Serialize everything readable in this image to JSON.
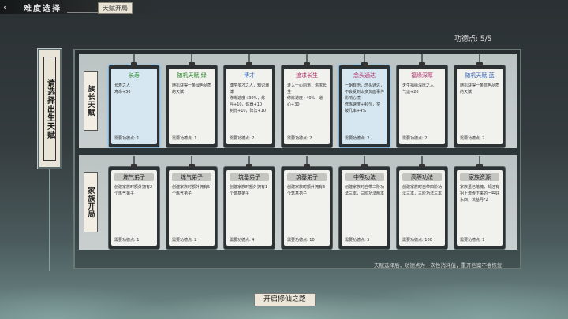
{
  "header": {
    "back_icon": "back-arrow-icon",
    "title": "难度选择",
    "tab_label": "天赋开局"
  },
  "points": {
    "label": "功德点: 5/5"
  },
  "side_label": "请选择出生天赋",
  "rows": [
    {
      "label": "族长天赋",
      "cards": [
        {
          "name": "长寿",
          "name_color": "#2a8a2a",
          "selected": true,
          "desc": "长寿之人",
          "effects": "寿命+50",
          "cost": "需要功德点: 1"
        },
        {
          "name": "随机天赋·绿",
          "name_color": "#2a8a2a",
          "selected": false,
          "desc": "随机获得一条绿色品质的天赋",
          "effects": "",
          "cost": "需要功德点: 1"
        },
        {
          "name": "博才",
          "name_color": "#3a6ab8",
          "selected": false,
          "desc": "博学多才之人，知识渊博",
          "effects": "修炼速度+30%，炼丹+10，炼器+10，制符+10，阵法+10",
          "cost": "需要功德点: 2"
        },
        {
          "name": "追求长生",
          "name_color": "#b0306a",
          "selected": false,
          "desc": "走入一心向道，追求长生",
          "effects": "修炼速度+40%，道心+30",
          "cost": "需要功德点: 2"
        },
        {
          "name": "念头通达",
          "name_color": "#b0306a",
          "selected": true,
          "desc": "一朝有悟，念头通达，不会受到太多负面事件影响心境",
          "effects": "修炼速度+40%，突破几率+4%",
          "cost": "需要功德点: 2"
        },
        {
          "name": "福缘深厚",
          "name_color": "#b0306a",
          "selected": false,
          "desc": "天生福缘深厚之人",
          "effects": "气运+20",
          "cost": "需要功德点: 2"
        },
        {
          "name": "随机天赋·蓝",
          "name_color": "#3a6ab8",
          "selected": false,
          "desc": "随机获得一条蓝色品质的天赋",
          "effects": "",
          "cost": "需要功德点: 2"
        }
      ]
    },
    {
      "label": "家族开局",
      "cards": [
        {
          "name": "炼气弟子",
          "selected": false,
          "desc": "创建家族时额外拥有2个炼气弟子",
          "cost": "需要功德点: 1"
        },
        {
          "name": "炼气弟子",
          "selected": false,
          "desc": "创建家族时额外拥有5个炼气弟子",
          "cost": "需要功德点: 2"
        },
        {
          "name": "筑基弟子",
          "selected": false,
          "desc": "创建家族时额外拥有1个筑基弟子",
          "cost": "需要功德点: 4"
        },
        {
          "name": "筑基弟子",
          "selected": false,
          "desc": "创建家族时额外拥有3个筑基弟子",
          "cost": "需要功德点: 10"
        },
        {
          "name": "中等功法",
          "selected": false,
          "desc": "创建家族时自带三阶功法三本，三阶功法两本",
          "cost": "需要功德点: 5"
        },
        {
          "name": "高等功法",
          "selected": false,
          "desc": "创建家族时自带四阶功法三本，三阶功法三本",
          "cost": "需要功德点: 100"
        },
        {
          "name": "家族资源",
          "selected": false,
          "desc": "家族虽已落魄，却还有祖上流传下来的一些好东西，筑基丹*2",
          "cost": "需要功德点: 1"
        }
      ]
    }
  ],
  "notice": "天赋选择后，功德点为一次性消耗值，重开档案不会恢复",
  "start_button": "开启修仙之路"
}
